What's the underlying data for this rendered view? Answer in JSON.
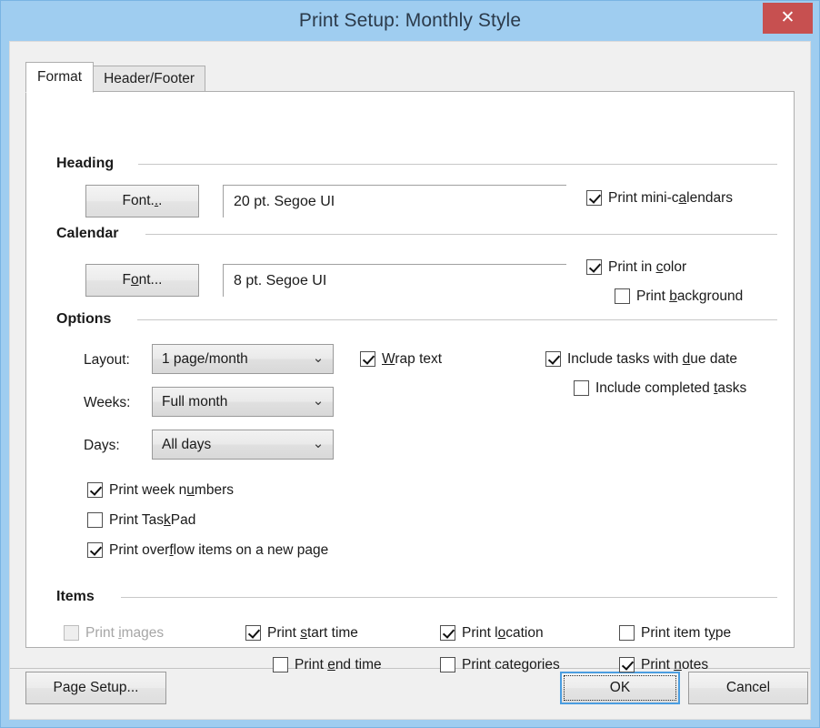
{
  "window": {
    "title": "Print Setup: Monthly Style",
    "close_label": "✕",
    "titlebar_color": "#9fcdf0",
    "close_color": "#c75050"
  },
  "tabs": [
    {
      "label": "Format",
      "active": true
    },
    {
      "label": "Header/Footer",
      "active": false
    }
  ],
  "groups": {
    "heading": {
      "label": "Heading"
    },
    "calendar": {
      "label": "Calendar"
    },
    "options": {
      "label": "Options"
    },
    "items": {
      "label": "Items"
    }
  },
  "heading": {
    "font_button": {
      "pre": "Font.",
      "mn": ".",
      "post": "."
    },
    "font_value": "20 pt. Segoe UI",
    "print_mini_calendars": {
      "pre": "Print mini-c",
      "mn": "a",
      "post": "lendars",
      "checked": true,
      "enabled": true
    }
  },
  "calendar": {
    "font_button": {
      "pre": "F",
      "mn": "o",
      "post": "nt..."
    },
    "font_value": "8 pt. Segoe UI",
    "print_in_color": {
      "pre": "Print in ",
      "mn": "c",
      "post": "olor",
      "checked": true,
      "enabled": true
    },
    "print_background": {
      "pre": "Print ",
      "mn": "b",
      "post": "ackground",
      "checked": false,
      "enabled": true
    }
  },
  "options": {
    "layout": {
      "label": "Layout:",
      "value": "1 page/month"
    },
    "weeks": {
      "label": "Weeks:",
      "value": "Full month"
    },
    "days": {
      "label": "Days:",
      "value": "All days"
    },
    "dropdown_arrow": "⌄",
    "wrap_text": {
      "pre": "",
      "mn": "W",
      "post": "rap text",
      "checked": true,
      "enabled": true
    },
    "include_tasks_due": {
      "pre": "Include tasks with ",
      "mn": "d",
      "post": "ue date",
      "checked": true,
      "enabled": true
    },
    "include_completed_tasks": {
      "pre": "Include completed ",
      "mn": "t",
      "post": "asks",
      "checked": false,
      "enabled": true
    },
    "print_week_numbers": {
      "pre": "Print week n",
      "mn": "u",
      "post": "mbers",
      "checked": true,
      "enabled": true
    },
    "print_taskpad": {
      "pre": "Print Tas",
      "mn": "k",
      "post": "Pad",
      "checked": false,
      "enabled": true
    },
    "print_overflow": {
      "pre": "Print over",
      "mn": "f",
      "post": "low items on a new page",
      "checked": true,
      "enabled": true
    }
  },
  "items": {
    "print_images": {
      "pre": "Print ",
      "mn": "i",
      "post": "mages",
      "checked": false,
      "enabled": false
    },
    "print_start_time": {
      "pre": "Print ",
      "mn": "s",
      "post": "tart time",
      "checked": true,
      "enabled": true
    },
    "print_end_time": {
      "pre": "Print ",
      "mn": "e",
      "post": "nd time",
      "checked": false,
      "enabled": true
    },
    "print_location": {
      "pre": "Print l",
      "mn": "o",
      "post": "cation",
      "checked": true,
      "enabled": true
    },
    "print_categories": {
      "pre": "Print cate",
      "mn": "g",
      "post": "ories",
      "checked": false,
      "enabled": true
    },
    "print_item_type": {
      "pre": "Print item t",
      "mn": "y",
      "post": "pe",
      "checked": false,
      "enabled": true
    },
    "print_notes": {
      "pre": "Print ",
      "mn": "n",
      "post": "otes",
      "checked": true,
      "enabled": true
    }
  },
  "footer": {
    "page_setup": {
      "pre": "Pa",
      "mn": "g",
      "post": "e Setup..."
    },
    "ok": "OK",
    "cancel": "Cancel",
    "default_border_color": "#4a9de0"
  }
}
